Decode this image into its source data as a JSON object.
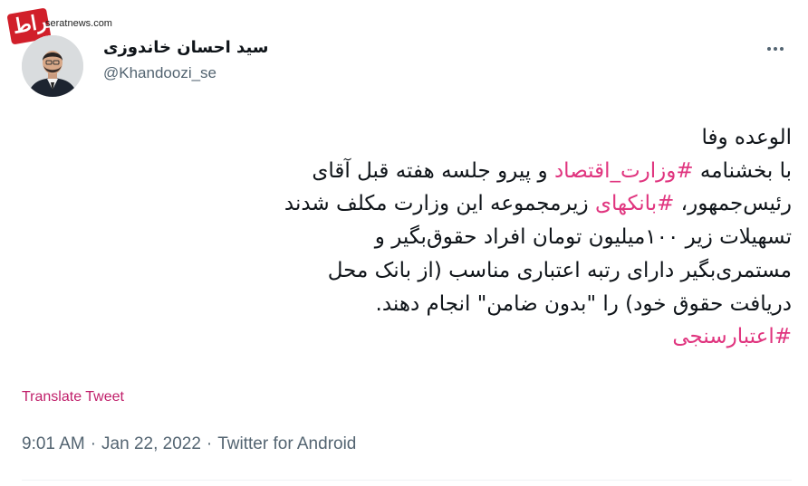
{
  "watermark": {
    "site": "seratnews.com",
    "logo_text": "صراط"
  },
  "author": {
    "name": "سید احسان خاندوزی",
    "handle": "@Khandoozi_se"
  },
  "tweet": {
    "line1": "الوعده وفا",
    "line2_pre": "با بخشنامه ",
    "hashtag1": "#وزارت_اقتصاد",
    "line2_post": " و پیرو جلسه هفته قبل آقای",
    "line3_pre": "رئیس‌جمهور، ",
    "hashtag2": "#بانکهای",
    "line3_post": " زیرمجموعه این وزارت مکلف شدند",
    "line4": "تسهیلات زیر ۱۰۰میلیون تومان افراد حقوق‌بگیر و",
    "line5": "مستمری‌بگیر دارای رتبه اعتباری مناسب (از بانک محل",
    "line6": "دریافت حقوق خود) را \"بدون ضامن\" انجام دهند.",
    "hashtag3": "#اعتبارسنجی"
  },
  "translate_label": "Translate Tweet",
  "meta": {
    "time": "9:01 AM",
    "date": "Jan 22, 2022",
    "source": "Twitter for Android",
    "separator": "·"
  },
  "colors": {
    "hashtag": "#e0357f",
    "translate": "#c01f6a",
    "secondary_text": "#536471"
  },
  "icons": {
    "more": "more-options-icon"
  }
}
